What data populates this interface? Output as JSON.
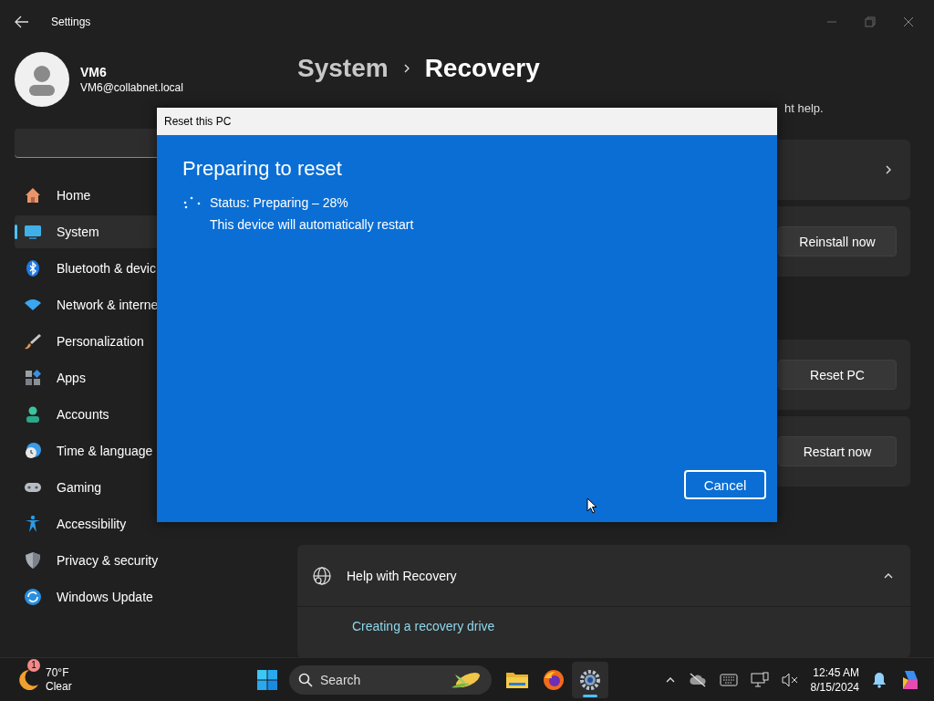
{
  "window": {
    "title": "Settings"
  },
  "profile": {
    "name": "VM6",
    "email": "VM6@collabnet.local"
  },
  "sidebar": {
    "items": [
      {
        "label": "Home",
        "selected": false
      },
      {
        "label": "System",
        "selected": true
      },
      {
        "label": "Bluetooth & devic",
        "selected": false
      },
      {
        "label": "Network & interne",
        "selected": false
      },
      {
        "label": "Personalization",
        "selected": false
      },
      {
        "label": "Apps",
        "selected": false
      },
      {
        "label": "Accounts",
        "selected": false
      },
      {
        "label": "Time & language",
        "selected": false
      },
      {
        "label": "Gaming",
        "selected": false
      },
      {
        "label": "Accessibility",
        "selected": false
      },
      {
        "label": "Privacy & security",
        "selected": false
      },
      {
        "label": "Windows Update",
        "selected": false
      }
    ]
  },
  "breadcrumb": [
    "System",
    "Recovery"
  ],
  "description": "ht help.",
  "cards": [
    {
      "kind": "link"
    },
    {
      "kind": "button",
      "button": "Reinstall now"
    },
    {
      "kind": "gap"
    },
    {
      "kind": "button",
      "button": "Reset PC"
    },
    {
      "kind": "button",
      "button": "Restart now"
    }
  ],
  "help": {
    "title": "Help with Recovery",
    "expanded": true,
    "links": [
      "Creating a recovery drive"
    ]
  },
  "dialog": {
    "title": "Reset this PC",
    "heading": "Preparing to reset",
    "status": "Status: Preparing – 28%",
    "note": "This device will automatically restart",
    "button": "Cancel"
  },
  "taskbar": {
    "weather": {
      "badge": "1",
      "temperature": "70°F",
      "condition": "Clear"
    },
    "search": {
      "placeholder": "Search"
    },
    "apps": [
      {
        "selected": false
      },
      {
        "selected": false
      },
      {
        "selected": true
      }
    ],
    "clock": {
      "time": "12:45 AM",
      "date": "8/15/2024"
    }
  }
}
